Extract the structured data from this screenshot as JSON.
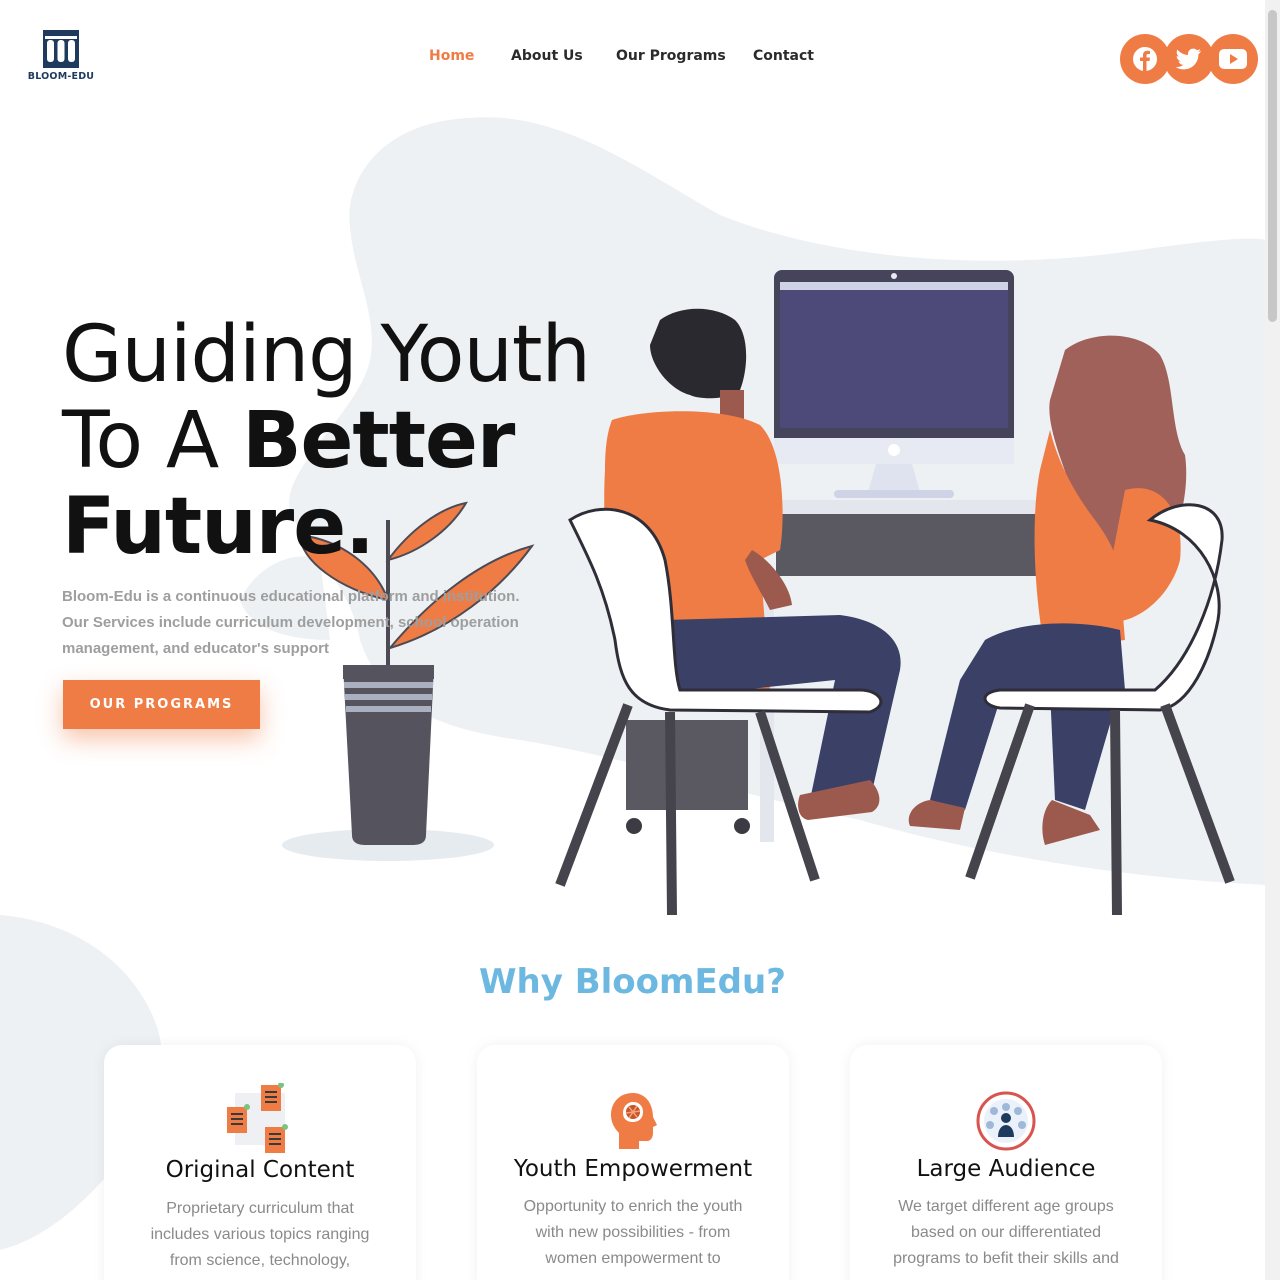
{
  "brand": {
    "name": "BLOOM-EDU",
    "logo_icon": "bloom-edu-logo",
    "color": "#1e3a5c"
  },
  "nav": {
    "items": [
      {
        "label": "Home",
        "active": true
      },
      {
        "label": "About Us",
        "active": false
      },
      {
        "label": "Our Programs",
        "active": false
      },
      {
        "label": "Contact",
        "active": false
      }
    ]
  },
  "social": [
    {
      "icon": "facebook-icon"
    },
    {
      "icon": "twitter-icon"
    },
    {
      "icon": "youtube-icon"
    }
  ],
  "hero": {
    "title_line1": "Guiding Youth",
    "title_line2_regular": "To A ",
    "title_line2_bold": "Better",
    "title_line3": "Future.",
    "description": "Bloom-Edu is a continuous educational platform and institution. Our Services include curriculum development, school operation management, and educator's support",
    "cta_label": "OUR PROGRAMS",
    "illustration": "two-people-at-computer-illustration"
  },
  "why": {
    "title": "Why BloomEdu?",
    "cards": [
      {
        "icon": "documents-icon",
        "title": "Original Content",
        "text": "Proprietary curriculum that includes various topics ranging from science, technology,"
      },
      {
        "icon": "brain-head-icon",
        "title": "Youth Empowerment",
        "text": "Opportunity to enrich the youth with new possibilities - from women empowerment to"
      },
      {
        "icon": "audience-icon",
        "title": "Large Audience",
        "text": "We target different age groups based on our differentiated programs to befit their skills and"
      }
    ]
  },
  "colors": {
    "accent": "#f07c45",
    "heading_blue": "#6cb8e0",
    "blob": "#edf1f4",
    "text_dark": "#111111",
    "text_muted": "#9e9e9e"
  }
}
